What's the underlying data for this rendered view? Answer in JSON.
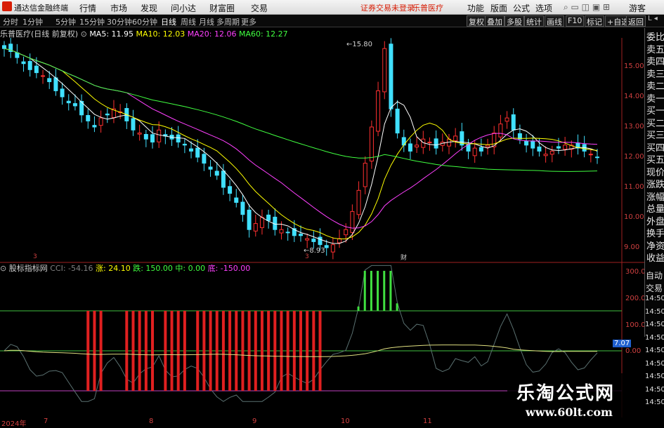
{
  "menubar": {
    "app_title": "通达信金融终端",
    "menus": [
      "行情",
      "市场",
      "发现",
      "问小达",
      "财富圈",
      "交易"
    ],
    "notice": "证券交易未登录",
    "notice_stock": "乐普医疗",
    "right_menus": [
      "功能",
      "版面",
      "公式",
      "选项"
    ],
    "guest": "游客"
  },
  "periodbar": {
    "periods": [
      "分时",
      "1分钟",
      "5分钟",
      "15分钟",
      "30分钟",
      "60分钟",
      "日线",
      "周线",
      "月线",
      "多周期",
      "更多"
    ],
    "active": "日线",
    "tools": [
      "复权",
      "叠加",
      "多股",
      "统计",
      "画线",
      "F10",
      "标记",
      "+自选",
      "返回"
    ]
  },
  "mabar": {
    "stock": "乐普医疗(日线 前复权)",
    "ma5": "MA5: 11.95",
    "ma10": "MA10: 12.03",
    "ma20": "MA20: 12.06",
    "ma60": "MA60: 12.27",
    "colors": {
      "ma5": "#ffffff",
      "ma10": "#ffff00",
      "ma20": "#ff40ff",
      "ma60": "#40ff40"
    }
  },
  "rightcol": [
    "委比",
    "卖五",
    "卖四",
    "卖三",
    "卖二",
    "卖一",
    "买一",
    "买二",
    "买三",
    "买四",
    "买五",
    "现价",
    "涨跌",
    "涨幅",
    "总量",
    "外盘",
    "换手",
    "净资",
    "收益"
  ],
  "rightcol2": [
    "自动",
    "交易"
  ],
  "price_axis": [
    "15.00",
    "14.00",
    "13.00",
    "12.00",
    "11.00",
    "10.00",
    "9.00"
  ],
  "price_annotations": {
    "high": "15.80",
    "low": "8.93"
  },
  "ind_axis": [
    "300.00",
    "200.00",
    "100.00",
    "0.00"
  ],
  "ind_axis_right": [
    "14:50",
    "14:50",
    "14:50",
    "14:50",
    "14:50",
    "14:50",
    "14:50",
    "14:50",
    "14:50"
  ],
  "ind_value_box": "7.07",
  "indicator": {
    "name": "股标指标网",
    "cci": "CCI: -54.16",
    "zhang": "涨: 24.10",
    "die": "跌: 150.00",
    "zhong": "中: 0.00",
    "di": "底: -150.00"
  },
  "xaxis": [
    "2024年",
    "7",
    "8",
    "9",
    "10",
    "11"
  ],
  "marker_labels": [
    "3",
    "3",
    "财"
  ],
  "watermark": {
    "cn": "乐淘公式网",
    "url": "www.60lt.com"
  }
}
